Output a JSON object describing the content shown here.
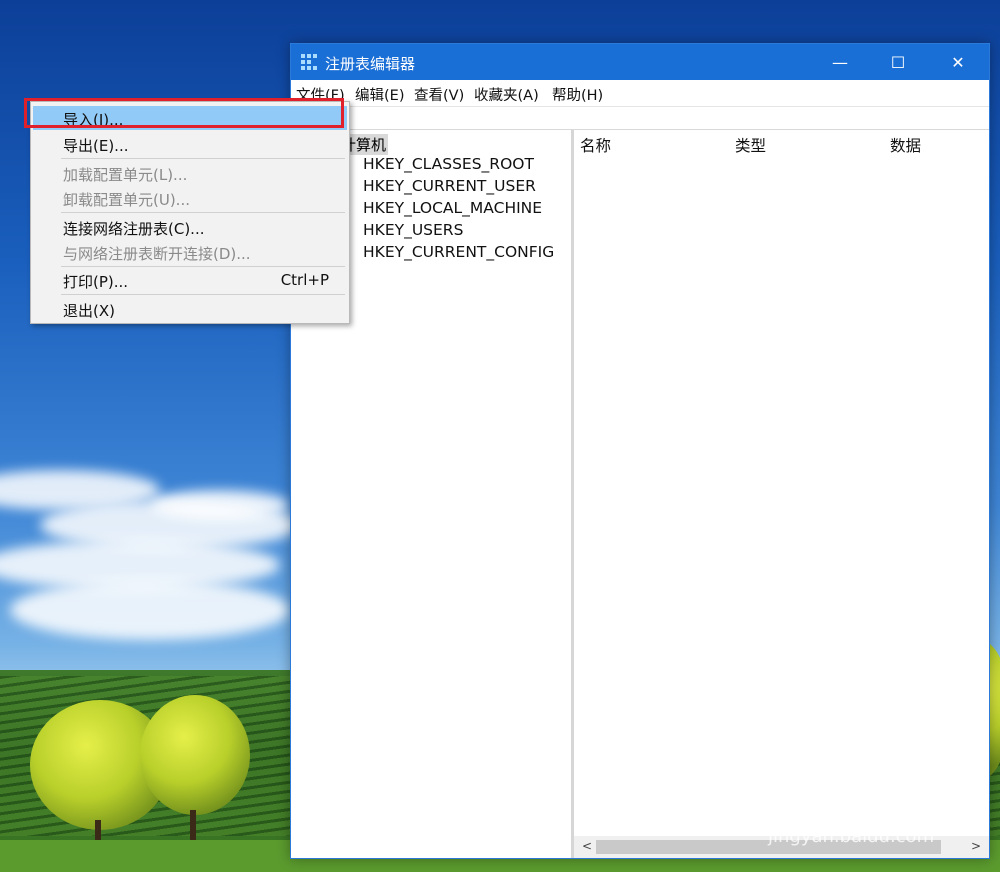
{
  "window": {
    "title": "注册表编辑器",
    "min": "—",
    "max": "☐",
    "close": "✕"
  },
  "menubar": {
    "file": "文件(F)",
    "edit": "编辑(E)",
    "view": "查看(V)",
    "favorites": "收藏夹(A)",
    "help": "帮助(H)"
  },
  "tree": {
    "root": "计算机",
    "items": [
      "HKEY_CLASSES_ROOT",
      "HKEY_CURRENT_USER",
      "HKEY_LOCAL_MACHINE",
      "HKEY_USERS",
      "HKEY_CURRENT_CONFIG"
    ]
  },
  "list": {
    "columns": [
      "名称",
      "类型",
      "数据"
    ]
  },
  "file_menu": {
    "items": [
      {
        "label": "导入(I)...",
        "shortcut": "",
        "enabled": true,
        "highlighted": true
      },
      {
        "label": "导出(E)...",
        "shortcut": "",
        "enabled": true
      },
      {
        "label": "加载配置单元(L)...",
        "shortcut": "",
        "enabled": false
      },
      {
        "label": "卸载配置单元(U)...",
        "shortcut": "",
        "enabled": false
      },
      {
        "label": "连接网络注册表(C)...",
        "shortcut": "",
        "enabled": true
      },
      {
        "label": "与网络注册表断开连接(D)...",
        "shortcut": "",
        "enabled": false
      },
      {
        "label": "打印(P)...",
        "shortcut": "Ctrl+P",
        "enabled": true
      },
      {
        "label": "退出(X)",
        "shortcut": "",
        "enabled": true
      }
    ]
  },
  "scrollbar": {
    "left_arrow": "<",
    "right_arrow": ">"
  },
  "watermark": {
    "main": "Bai du 经验",
    "sub": "jingyan.baidu.com"
  }
}
